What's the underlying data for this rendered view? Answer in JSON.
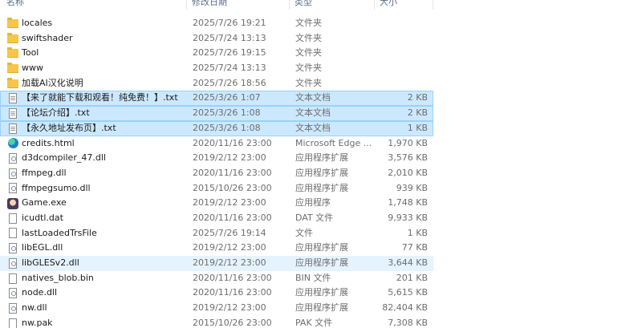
{
  "columns": {
    "name": "名称",
    "date": "修改日期",
    "type": "类型",
    "size": "大小"
  },
  "files": [
    {
      "name": "locales",
      "date": "2025/7/26 19:21",
      "type": "文件夹",
      "size": "",
      "icon": "folder-icon",
      "state": ""
    },
    {
      "name": "swiftshader",
      "date": "2025/7/24 13:13",
      "type": "文件夹",
      "size": "",
      "icon": "folder-icon",
      "state": ""
    },
    {
      "name": "Tool",
      "date": "2025/7/26 19:15",
      "type": "文件夹",
      "size": "",
      "icon": "folder-icon",
      "state": ""
    },
    {
      "name": "www",
      "date": "2025/7/24 13:13",
      "type": "文件夹",
      "size": "",
      "icon": "folder-icon",
      "state": ""
    },
    {
      "name": "加载AI汉化说明",
      "date": "2025/7/26 18:56",
      "type": "文件夹",
      "size": "",
      "icon": "folder-icon",
      "state": ""
    },
    {
      "name": "【来了就能下载和观看！纯免费！】.txt",
      "date": "2025/3/26 1:07",
      "type": "文本文档",
      "size": "2 KB",
      "icon": "text-file-icon",
      "state": "selected"
    },
    {
      "name": "【论坛介绍】.txt",
      "date": "2025/3/26 1:08",
      "type": "文本文档",
      "size": "2 KB",
      "icon": "text-file-icon",
      "state": "selected"
    },
    {
      "name": "【永久地址发布页】.txt",
      "date": "2025/3/26 1:08",
      "type": "文本文档",
      "size": "1 KB",
      "icon": "text-file-icon",
      "state": "selected"
    },
    {
      "name": "credits.html",
      "date": "2020/11/16 23:00",
      "type": "Microsoft Edge ...",
      "size": "1,970 KB",
      "icon": "edge-icon",
      "state": ""
    },
    {
      "name": "d3dcompiler_47.dll",
      "date": "2019/2/12 23:00",
      "type": "应用程序扩展",
      "size": "3,576 KB",
      "icon": "dll-file-icon",
      "state": ""
    },
    {
      "name": "ffmpeg.dll",
      "date": "2020/11/16 23:00",
      "type": "应用程序扩展",
      "size": "2,010 KB",
      "icon": "dll-file-icon",
      "state": ""
    },
    {
      "name": "ffmpegsumo.dll",
      "date": "2015/10/26 23:00",
      "type": "应用程序扩展",
      "size": "939 KB",
      "icon": "dll-file-icon",
      "state": ""
    },
    {
      "name": "Game.exe",
      "date": "2019/2/12 23:00",
      "type": "应用程序",
      "size": "1,748 KB",
      "icon": "game-icon",
      "state": ""
    },
    {
      "name": "icudtl.dat",
      "date": "2020/11/16 23:00",
      "type": "DAT 文件",
      "size": "9,933 KB",
      "icon": "file-icon",
      "state": ""
    },
    {
      "name": "lastLoadedTrsFile",
      "date": "2025/7/26 19:14",
      "type": "文件",
      "size": "1 KB",
      "icon": "file-icon",
      "state": ""
    },
    {
      "name": "libEGL.dll",
      "date": "2019/2/12 23:00",
      "type": "应用程序扩展",
      "size": "77 KB",
      "icon": "dll-file-icon",
      "state": ""
    },
    {
      "name": "libGLESv2.dll",
      "date": "2019/2/12 23:00",
      "type": "应用程序扩展",
      "size": "3,644 KB",
      "icon": "dll-file-icon",
      "state": "hover"
    },
    {
      "name": "natives_blob.bin",
      "date": "2020/11/16 23:00",
      "type": "BIN 文件",
      "size": "201 KB",
      "icon": "file-icon",
      "state": ""
    },
    {
      "name": "node.dll",
      "date": "2020/11/16 23:00",
      "type": "应用程序扩展",
      "size": "5,615 KB",
      "icon": "dll-file-icon",
      "state": ""
    },
    {
      "name": "nw.dll",
      "date": "2019/2/12 23:00",
      "type": "应用程序扩展",
      "size": "82,404 KB",
      "icon": "dll-file-icon",
      "state": ""
    },
    {
      "name": "nw.pak",
      "date": "2015/10/26 23:00",
      "type": "PAK 文件",
      "size": "7,308 KB",
      "icon": "file-icon",
      "state": ""
    }
  ]
}
